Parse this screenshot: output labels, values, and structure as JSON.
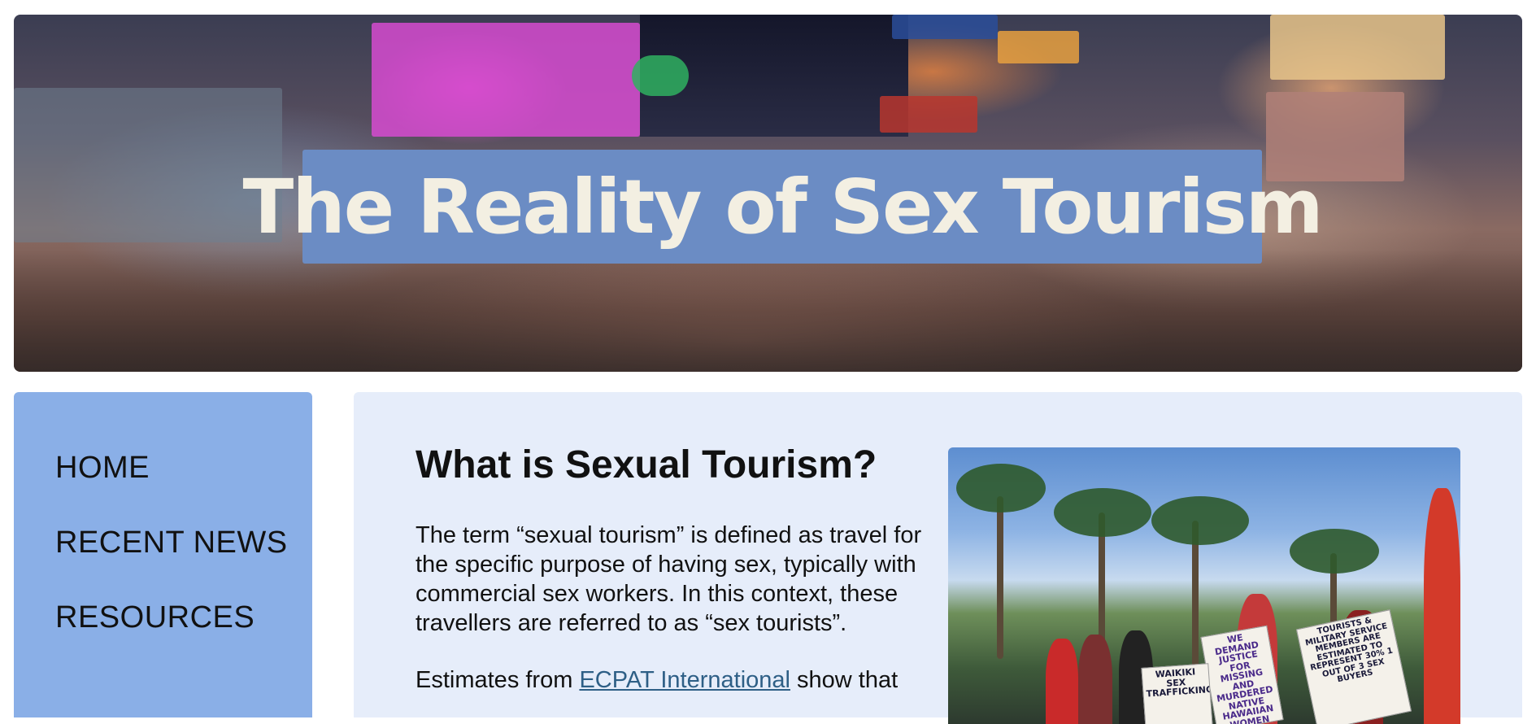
{
  "hero": {
    "title": "The Reality of Sex Tourism",
    "title_box_color": "#6b8cc4",
    "title_text_color": "#f3efe2"
  },
  "sidebar": {
    "background": "#8aafe7",
    "items": [
      {
        "label": "HOME"
      },
      {
        "label": "RECENT NEWS"
      },
      {
        "label": "RESOURCES"
      }
    ]
  },
  "main": {
    "background": "#e6edfa",
    "heading": "What is Sexual Tourism?",
    "paragraph1": "The term “sexual tourism” is defined as travel for the specific purpose of having sex, typically with commercial sex workers. In this context, these travellers are referred to as “sex tourists”.",
    "paragraph2": {
      "before_link": "Estimates from ",
      "link_text": "ECPAT International",
      "after_link": " show that"
    },
    "link_color": "#2e5f86"
  },
  "photo": {
    "signs": [
      "WE DEMAND JUSTICE FOR MISSING AND MURDERED NATIVE HAWAIIAN WOMEN",
      "WAIKIKI SEX TRAFFICKING",
      "TOURISTS & MILITARY SERVICE MEMBERS ARE ESTIMATED TO REPRESENT 30% 1 OUT OF 3 SEX BUYERS"
    ]
  }
}
